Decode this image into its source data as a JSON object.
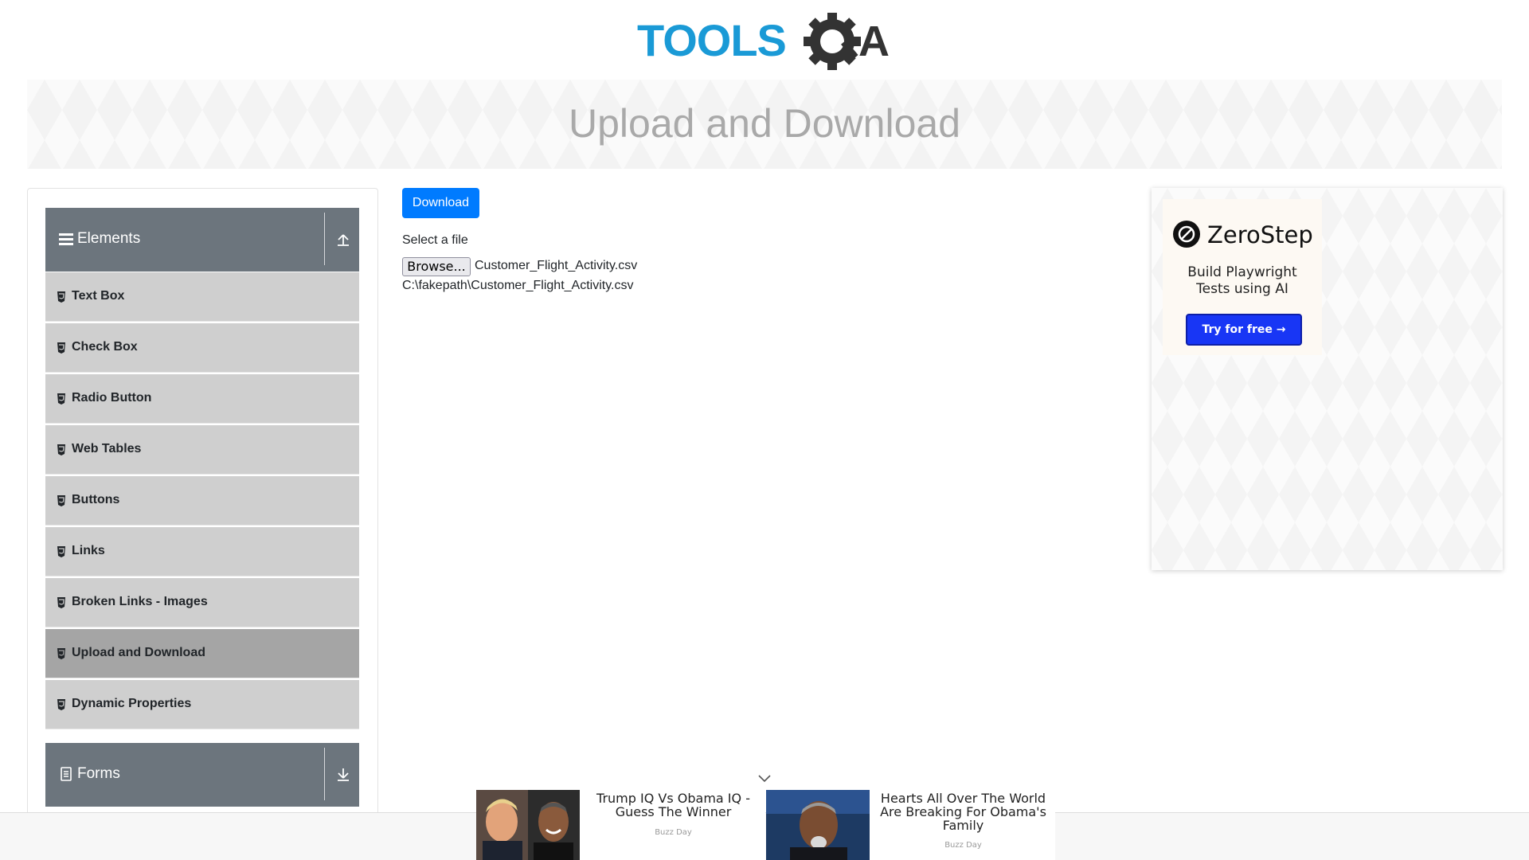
{
  "banner": {
    "title": "Upload and Download"
  },
  "logo": {
    "text_tools": "TOOLS",
    "text_qa": "QA",
    "colors": {
      "tools": "#1a9ad6",
      "qa": "#333333"
    }
  },
  "sidebar": {
    "elements_group": {
      "label": "Elements",
      "icon": "hamburger-icon",
      "toggle_icon": "collapse-up-icon"
    },
    "items": [
      {
        "label": "Text Box"
      },
      {
        "label": "Check Box"
      },
      {
        "label": "Radio Button"
      },
      {
        "label": "Web Tables"
      },
      {
        "label": "Buttons"
      },
      {
        "label": "Links"
      },
      {
        "label": "Broken Links - Images"
      },
      {
        "label": "Upload and Download",
        "active": true
      },
      {
        "label": "Dynamic Properties"
      }
    ],
    "forms_group": {
      "label": "Forms",
      "icon": "form-icon",
      "toggle_icon": "expand-down-icon"
    }
  },
  "main": {
    "download_label": "Download",
    "select_file_label": "Select a file",
    "browse_label": "Browse...",
    "file_name": "Customer_Flight_Activity.csv",
    "uploaded_path": "C:\\fakepath\\Customer_Flight_Activity.csv"
  },
  "ad": {
    "brand": "ZeroStep",
    "text_line1": "Build Playwright",
    "text_line2": "Tests using AI",
    "cta": "Try for free →",
    "accent": "#1836f5"
  },
  "bottom_ads": [
    {
      "title": "Trump IQ Vs Obama IQ - Guess The Winner",
      "source": "Buzz Day"
    },
    {
      "title": "Hearts All Over The World Are Breaking For Obama's Family",
      "source": "Buzz Day"
    }
  ],
  "colors": {
    "primary": "#007bff",
    "sidebar_header": "#6c757d",
    "menu_item": "#cfcfcf",
    "menu_active": "#a5a5a5"
  }
}
